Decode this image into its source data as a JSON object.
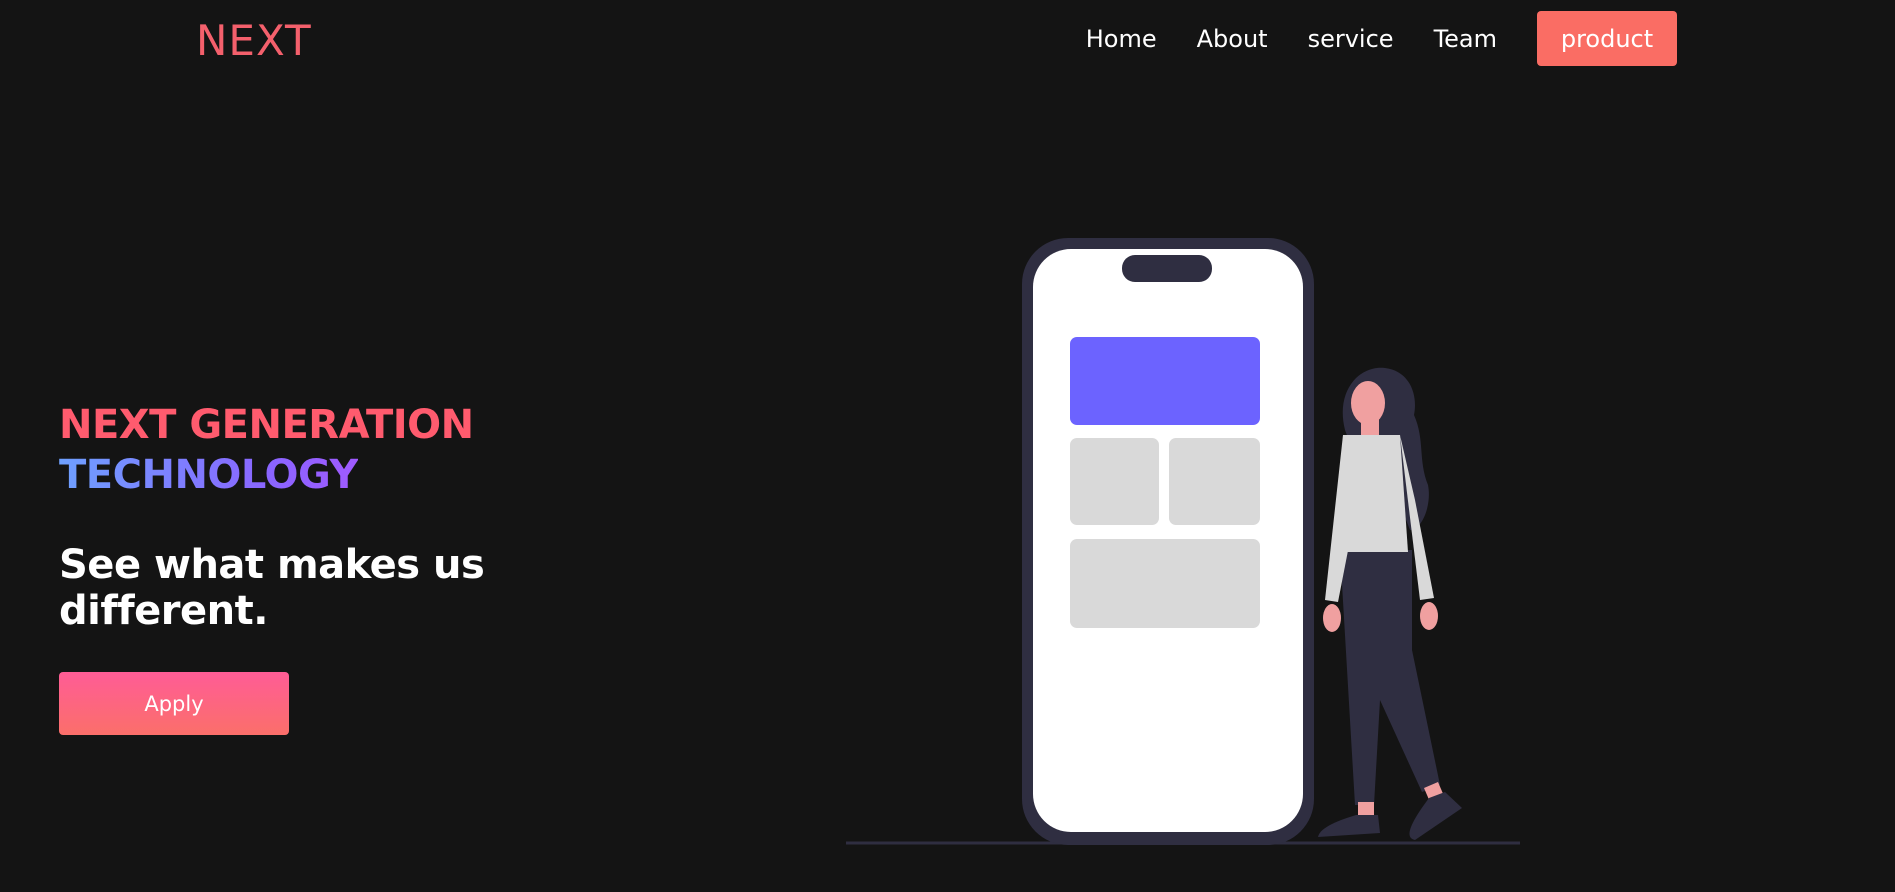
{
  "header": {
    "logo": "NEXT",
    "nav": [
      "Home",
      "About",
      "service",
      "Team"
    ],
    "cta": "product"
  },
  "hero": {
    "headline_line1": "NEXT GENERATION",
    "headline_line2": "TECHNOLOGY",
    "tagline": "See what makes us different.",
    "apply_label": "Apply"
  },
  "colors": {
    "accent": "#fa6d64",
    "logo": "#f4606c",
    "background": "#141414",
    "illustration_purple": "#6c63ff"
  }
}
